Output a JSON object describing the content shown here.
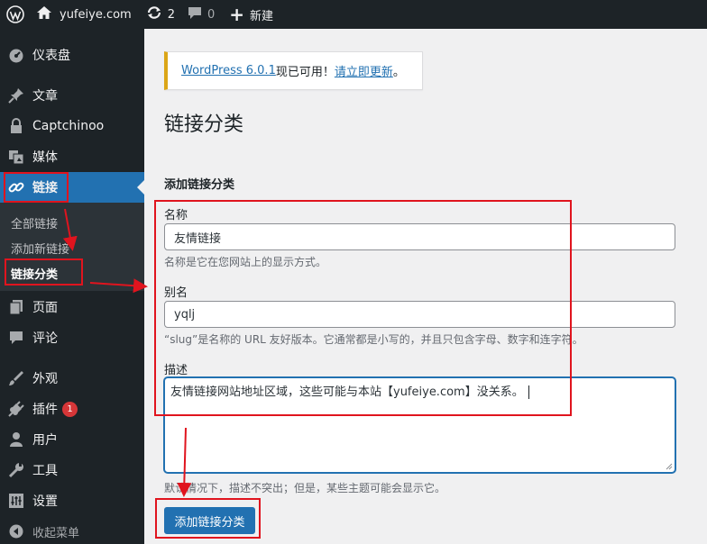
{
  "admin_bar": {
    "site_name": "yufeiye.com",
    "updates_count": "2",
    "comments_count": "0",
    "new_label": "新建"
  },
  "sidebar": {
    "items": [
      {
        "label": "仪表盘",
        "icon": "dashboard-icon"
      },
      {
        "label": "文章",
        "icon": "pin-icon"
      },
      {
        "label": "Captchinoo",
        "icon": "lock-icon"
      },
      {
        "label": "媒体",
        "icon": "media-icon"
      },
      {
        "label": "链接",
        "icon": "link-icon"
      },
      {
        "label": "页面",
        "icon": "page-icon"
      },
      {
        "label": "评论",
        "icon": "comment-icon"
      },
      {
        "label": "外观",
        "icon": "appearance-icon"
      },
      {
        "label": "插件",
        "icon": "plugin-icon",
        "badge": "1"
      },
      {
        "label": "用户",
        "icon": "user-icon"
      },
      {
        "label": "工具",
        "icon": "wrench-icon"
      },
      {
        "label": "设置",
        "icon": "settings-icon"
      },
      {
        "label": "收起菜单",
        "icon": "collapse-icon"
      }
    ],
    "submenu": [
      "全部链接",
      "添加新链接",
      "链接分类"
    ]
  },
  "notice": {
    "link1": "WordPress 6.0.1",
    "text": "现已可用！",
    "link2": "请立即更新",
    "end": "。"
  },
  "page_title": "链接分类",
  "form": {
    "title": "添加链接分类",
    "name_label": "名称",
    "name_value": "友情链接",
    "name_desc": "名称是它在您网站上的显示方式。",
    "slug_label": "别名",
    "slug_value": "yqlj",
    "slug_desc": "“slug”是名称的 URL 友好版本。它通常都是小写的，并且只包含字母、数字和连字符。",
    "desc_label": "描述",
    "desc_value": "友情链接网站地址区域，这些可能与本站【yufeiye.com】没关系。",
    "desc_desc": "默认情况下，描述不突出；但是，某些主题可能会显示它。",
    "submit_label": "添加链接分类"
  },
  "colors": {
    "admin_dark": "#1d2327",
    "accent": "#2271b1",
    "annotation_red": "#e0141e",
    "notice_border": "#dba617"
  }
}
